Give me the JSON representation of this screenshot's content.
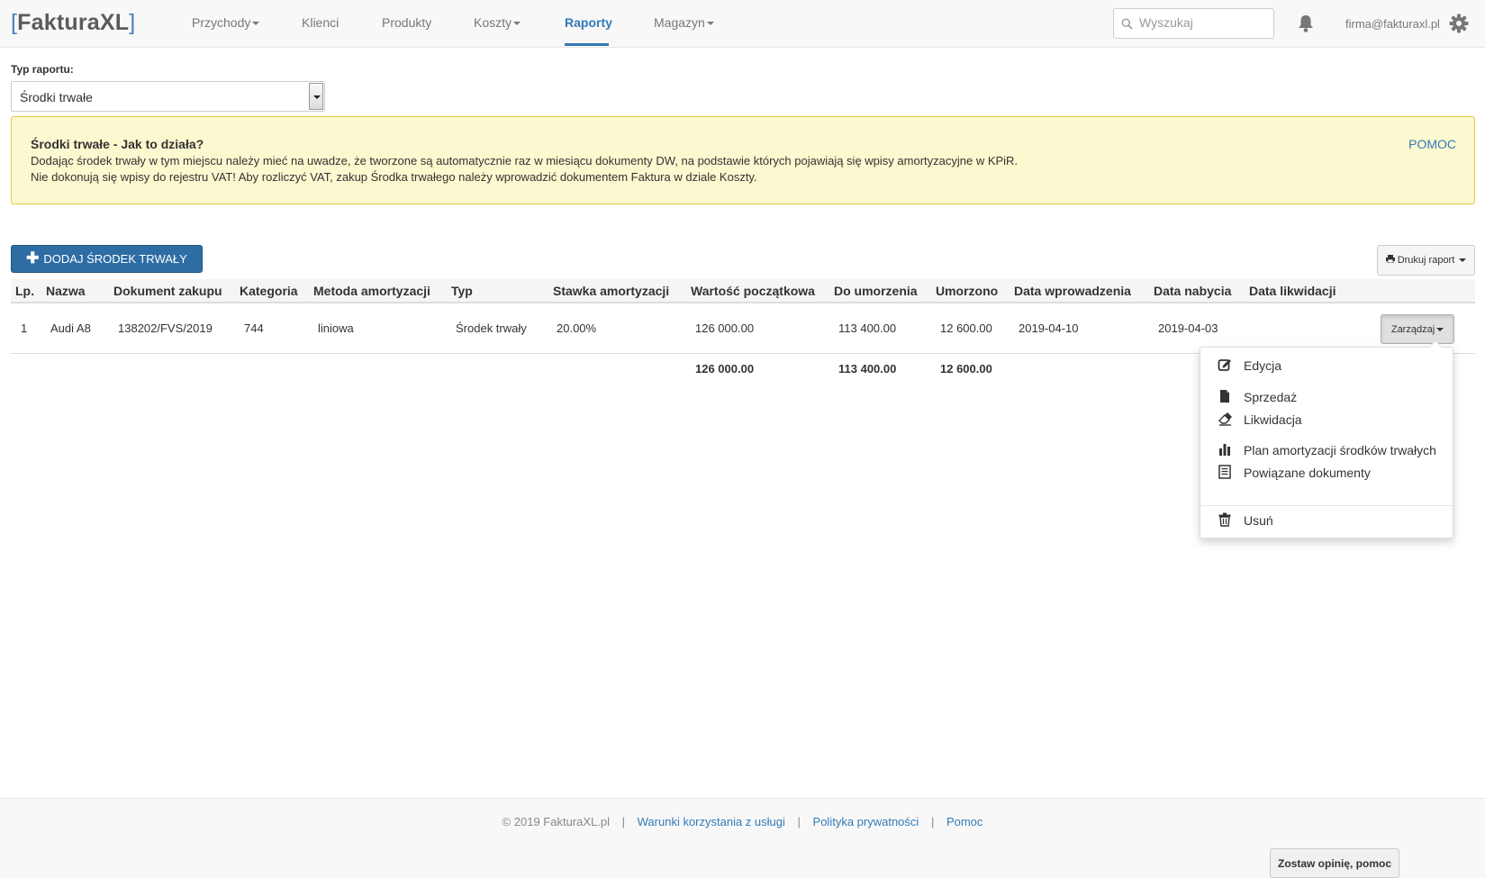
{
  "navbar": {
    "brand_open": "[",
    "brand_name": "FakturaXL",
    "brand_close": "]",
    "items": [
      {
        "label": "Przychody",
        "has_caret": true
      },
      {
        "label": "Klienci",
        "has_caret": false
      },
      {
        "label": "Produkty",
        "has_caret": false
      },
      {
        "label": "Koszty",
        "has_caret": true
      },
      {
        "label": "Raporty",
        "has_caret": false,
        "active": true
      },
      {
        "label": "Magazyn",
        "has_caret": true
      }
    ],
    "search_placeholder": "Wyszukaj",
    "user_email": "firma@fakturaxl.pl"
  },
  "report": {
    "type_label": "Typ raportu:",
    "type_value": "Środki trwałe"
  },
  "alert": {
    "title": "Środki trwałe - Jak to działa?",
    "line1": "Dodając środek trwały w tym miejscu należy mieć na uwadze, że tworzone są automatycznie raz w miesiącu dokumenty DW, na podstawie których pojawiają się wpisy amortyzacyjne w KPiR.",
    "line2": "Nie dokonują się wpisy do rejestru VAT! Aby rozliczyć VAT, zakup Środka trwałego należy wprowadzić dokumentem Faktura w dziale Koszty.",
    "help_link": "POMOC"
  },
  "actions": {
    "add_label": "DODAJ ŚRODEK TRWAŁY",
    "print_label": "Drukuj raport"
  },
  "table": {
    "headers": [
      "Lp.",
      "Nazwa",
      "Dokument zakupu",
      "Kategoria",
      "Metoda amortyzacji",
      "Typ",
      "Stawka amortyzacji",
      "Wartość początkowa",
      "Do umorzenia",
      "Umorzono",
      "Data wprowadzenia",
      "Data nabycia",
      "Data likwidacji"
    ],
    "rows": [
      {
        "lp": "1",
        "nazwa": "Audi A8",
        "dokument": "138202/FVS/2019",
        "kategoria": "744",
        "metoda": "liniowa",
        "typ": "Środek trwały",
        "stawka": "20.00%",
        "wartosc": "126 000.00",
        "do_umorzenia": "113 400.00",
        "umorzono": "12 600.00",
        "data_wprowadzenia": "2019-04-10",
        "data_nabycia": "2019-04-03",
        "data_likwidacji": "",
        "manage_label": "Zarządzaj"
      }
    ],
    "totals": {
      "wartosc": "126 000.00",
      "do_umorzenia": "113 400.00",
      "umorzono": "12 600.00"
    }
  },
  "dropdown": {
    "items": [
      {
        "label": "Edycja",
        "icon": "edit-icon"
      },
      {
        "label": "Sprzedaż",
        "icon": "file-icon"
      },
      {
        "label": "Likwidacja",
        "icon": "eraser-icon"
      },
      {
        "label": "Plan amortyzacji środków trwałych",
        "icon": "bar-chart-icon"
      },
      {
        "label": "Powiązane dokumenty",
        "icon": "list-icon"
      },
      {
        "label": "Usuń",
        "icon": "trash-icon"
      }
    ]
  },
  "footer": {
    "copyright": "© 2019 FakturaXL.pl",
    "terms": "Warunki korzystania z usługi",
    "privacy": "Polityka prywatności",
    "help": "Pomoc",
    "separator": "|",
    "feedback": "Zostaw opinię, pomoc"
  },
  "colors": {
    "accent": "#337ab7",
    "primary_button": "#2e6da4",
    "alert_bg": "#fcf8cf",
    "alert_border": "#e8c84c"
  }
}
